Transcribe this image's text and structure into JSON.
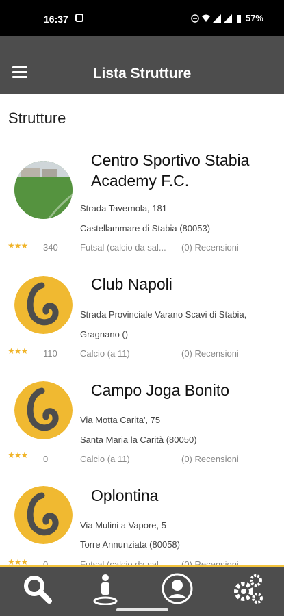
{
  "status": {
    "time": "16:37",
    "battery": "57%"
  },
  "header": {
    "title": "Lista Strutture"
  },
  "section": {
    "title": "Strutture"
  },
  "items": [
    {
      "name_line1": "Centro Sportivo Stabia",
      "name_line2": "Academy F.C.",
      "address": "Strada Tavernola, 181",
      "city": "Castellammare di Stabia (80053)",
      "sport": "Futsal (calcio da sal...",
      "reviews": "(0) Recensioni",
      "count": "340",
      "stars": "★★★"
    },
    {
      "name_line1": "Club Napoli",
      "address": "Strada Provinciale Varano Scavi di Stabia,",
      "city": "Gragnano ()",
      "sport": "Calcio (a 11)",
      "reviews": "(0) Recensioni",
      "count": "110",
      "stars": "★★★"
    },
    {
      "name_line1": "Campo Joga Bonito",
      "address": "Via Motta Carita', 75",
      "city": "Santa Maria la Carità (80050)",
      "sport": "Calcio (a 11)",
      "reviews": "(0) Recensioni",
      "count": "0",
      "stars": "★★★"
    },
    {
      "name_line1": "Oplontina",
      "address": "Via Mulini a Vapore, 5",
      "city": "Torre Annunziata (80058)",
      "sport": "Futsal (calcio da sal...",
      "reviews": "(0) Recensioni",
      "count": "0",
      "stars": "★★★"
    }
  ],
  "nav": [
    {
      "icon": "search-icon"
    },
    {
      "icon": "person-pin-icon"
    },
    {
      "icon": "account-icon"
    },
    {
      "icon": "settings-gears-icon"
    }
  ],
  "colors": {
    "app_bar": "#4d4d4d",
    "accent": "#f3c33d",
    "star": "#f0b429"
  }
}
